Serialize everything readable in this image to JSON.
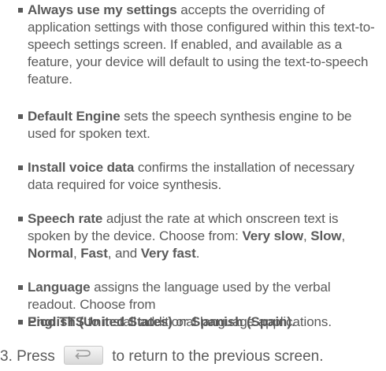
{
  "bullets": [
    {
      "term": "Always use my settings",
      "text": " accepts the overriding of application settings with those configured within this text-to-speech settings screen. If enabled, and available as a feature, your device will default to using the text-to-speech feature."
    },
    {
      "term": "Default Engine",
      "text": " sets the speech synthesis engine to be used for spoken text."
    },
    {
      "term": "Install voice data",
      "text": " confirms the installation of necessary data required for voice synthesis."
    },
    {
      "term": "Speech rate",
      "text": " adjust the rate at which onscreen text is spoken by the device. Choose from: ",
      "options": [
        "Very slow",
        "Slow",
        "Normal",
        "Fast",
        "Very fast"
      ],
      "sep1": ", ",
      "sep_and": ", and ",
      "end": "."
    },
    {
      "term": "Language",
      "text": " assigns the language used by the verbal readout. Choose from",
      "option_a": "English (United States)",
      "or": " or ",
      "option_b": "Spanish (Spain)",
      "end": "."
    },
    {
      "term": "Pico TTS",
      "text": " to install additional language applications."
    }
  ],
  "step": {
    "number": "3.",
    "before": " Press ",
    "after": " to return to the previous screen.",
    "button_icon": "back-arrow-icon"
  }
}
